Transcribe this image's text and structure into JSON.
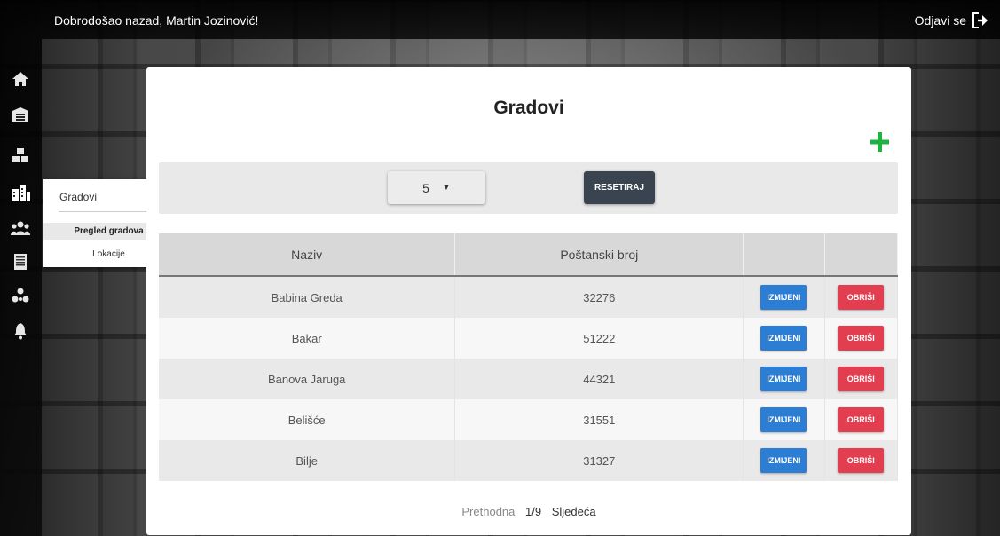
{
  "topbar": {
    "welcome": "Dobrodošao nazad, Martin Jozinović!",
    "logout_label": "Odjavi se"
  },
  "sidebar": {
    "icons": [
      "home-icon",
      "warehouse-icon",
      "boxes-icon",
      "city-icon",
      "users-icon",
      "documents-icon",
      "sitemap-icon",
      "bell-icon"
    ]
  },
  "flyout": {
    "title": "Gradovi",
    "items": [
      "Pregled gradova",
      "Lokacije"
    ]
  },
  "card": {
    "title": "Gradovi",
    "page_size": "5",
    "reset_label": "RESETIRAJ"
  },
  "table": {
    "headers": [
      "Naziv",
      "Poštanski broj",
      "",
      ""
    ],
    "edit_label": "IZMIJENI",
    "delete_label": "OBRIŠI",
    "rows": [
      {
        "name": "Babina Greda",
        "zip": "32276"
      },
      {
        "name": "Bakar",
        "zip": "51222"
      },
      {
        "name": "Banova Jaruga",
        "zip": "44321"
      },
      {
        "name": "Belišće",
        "zip": "31551"
      },
      {
        "name": "Bilje",
        "zip": "31327"
      }
    ]
  },
  "pager": {
    "prev": "Prethodna",
    "current": "1/9",
    "next": "Sljedeća"
  },
  "colors": {
    "accent_green": "#1fb141",
    "edit_blue": "#2c7dd4",
    "delete_red": "#e23e50",
    "reset_dark": "#3a4450"
  }
}
